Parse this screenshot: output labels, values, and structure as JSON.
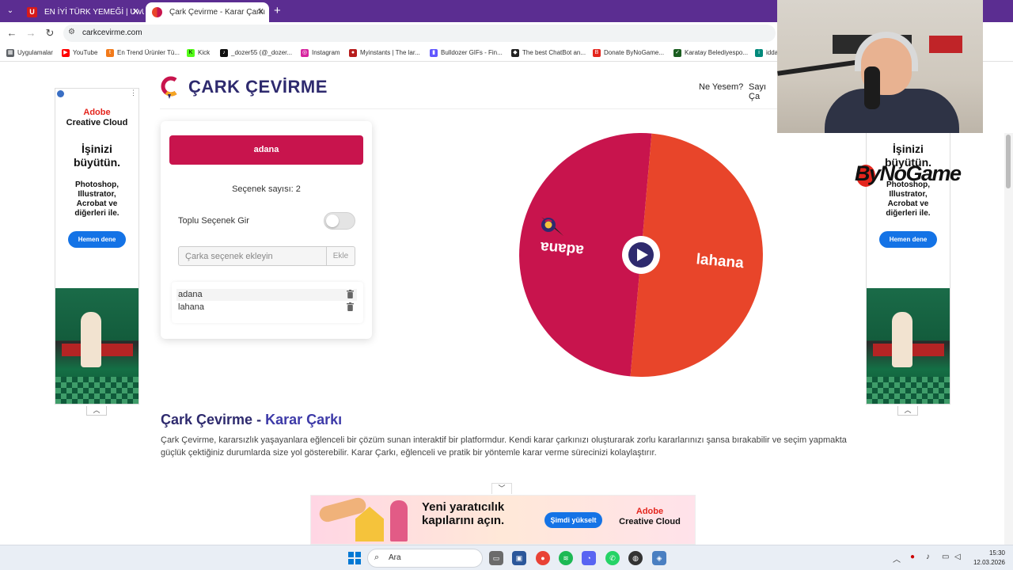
{
  "browser": {
    "tabs": [
      {
        "title": "EN İYİ TÜRK YEMEĞİ | UwUFUFU",
        "favicon": "U"
      },
      {
        "title": "Çark Çevirme - Karar Çarkı",
        "favicon": ""
      }
    ],
    "url": "carkcevirme.com",
    "bookmarks": [
      {
        "label": "Uygulamalar",
        "icon": "apps-grid-icon",
        "color": "#5f6368"
      },
      {
        "label": "YouTube",
        "icon": "youtube-icon",
        "color": "#ff0000"
      },
      {
        "label": "En Trend Ürünler Tü...",
        "icon": "trendyol-icon",
        "color": "#f27a1a"
      },
      {
        "label": "Kick",
        "icon": "kick-icon",
        "color": "#53fc18"
      },
      {
        "label": "_dozer55 (@_dozer...",
        "icon": "tiktok-icon",
        "color": "#111111"
      },
      {
        "label": "Instagram",
        "icon": "instagram-icon",
        "color": "#d6249f"
      },
      {
        "label": "Myinstants | The lar...",
        "icon": "myinstants-icon",
        "color": "#b71c1c"
      },
      {
        "label": "Bulldozer GIFs - Fin...",
        "icon": "giphy-icon",
        "color": "#6157ff"
      },
      {
        "label": "The best ChatBot an...",
        "icon": "chatbot-icon",
        "color": "#222222"
      },
      {
        "label": "Donate ByNoGame...",
        "icon": "bynogame-icon",
        "color": "#e4251d"
      },
      {
        "label": "Karatay Belediyespo...",
        "icon": "karatay-icon",
        "color": "#1b5e20"
      },
      {
        "label": "idda",
        "icon": "idda-icon",
        "color": "#00897b"
      }
    ]
  },
  "site": {
    "logo_text": "ÇARK ÇEVİRME",
    "nav": [
      "Ne Yesem?",
      "Sayı Ça"
    ]
  },
  "panel": {
    "result": "adana",
    "count_label": "Seçenek sayısı: 2",
    "toggle_label": "Toplu Seçenek Gir",
    "toggle_on": false,
    "input_placeholder": "Çarka seçenek ekleyin",
    "add_button": "Ekle",
    "options": [
      "adana",
      "lahana"
    ]
  },
  "wheel": {
    "segments": [
      {
        "label": "adana",
        "color": "#c8144d"
      },
      {
        "label": "lahana",
        "color": "#e8452a"
      }
    ],
    "rotation_deg": 185
  },
  "article": {
    "title_main": "Çark Çevirme - ",
    "title_accent": "Karar Çarkı",
    "text": "Çark Çevirme, kararsızlık yaşayanlara eğlenceli bir çözüm sunan interaktif bir platformdur. Kendi karar çarkınızı oluşturarak zorlu kararlarınızı şansa bırakabilir ve seçim yapmakta güçlük çektiğiniz durumlarda size yol gösterebilir. Karar Çarkı, eğlenceli ve pratik bir yöntemle karar verme sürecinizi kolaylaştırır."
  },
  "ads": {
    "side_brand_1": "Adobe",
    "side_brand_2": "Creative Cloud",
    "side_headline_1": "İşinizi",
    "side_headline_2": "büyütün.",
    "side_body": [
      "Photoshop,",
      "Illustrator,",
      "Acrobat ve",
      "diğerleri ile."
    ],
    "side_cta": "Hemen dene",
    "bottom_headline_1": "Yeni yaratıcılık",
    "bottom_headline_2": "kapılarını açın.",
    "bottom_cta": "Şimdi yükselt",
    "bottom_brand_1": "Adobe",
    "bottom_brand_2": "Creative Cloud"
  },
  "overlay": {
    "stream_logo": "ByNoGame"
  },
  "taskbar": {
    "search_label": "Ara",
    "time": "15:30",
    "date": "12.03.2026"
  },
  "colors": {
    "brand_dark": "#2e2a6e",
    "accent_red": "#c8144d",
    "accent_orange": "#e8452a",
    "browser_purple": "#5b2d91",
    "adobe_blue": "#1473e6"
  }
}
